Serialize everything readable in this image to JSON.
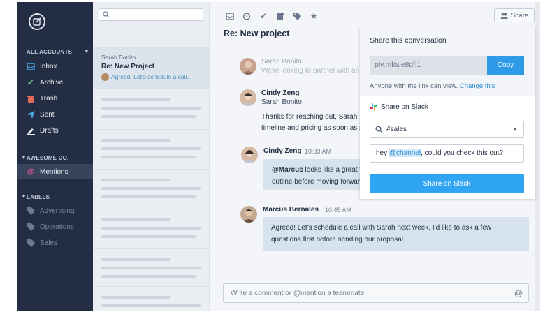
{
  "sidebar": {
    "all_accounts_label": "ALL ACCOUNTS",
    "items": [
      {
        "label": "Inbox",
        "icon": "inbox-icon"
      },
      {
        "label": "Archive",
        "icon": "check-icon"
      },
      {
        "label": "Trash",
        "icon": "trash-icon"
      },
      {
        "label": "Sent",
        "icon": "send-icon"
      },
      {
        "label": "Drafts",
        "icon": "pencil-icon"
      }
    ],
    "team_label": "AWESOME CO.",
    "mentions_label": "Mentions",
    "labels_label": "LABELS",
    "labels": [
      {
        "label": "Advertising"
      },
      {
        "label": "Operations"
      },
      {
        "label": "Sales"
      }
    ]
  },
  "list": {
    "selected": {
      "sender": "Sarah Bonito",
      "subject": "Re:  New Project",
      "preview": "Agreed! Let's schedule a call..."
    }
  },
  "conversation": {
    "title": "Re: New project",
    "share_label": "Share",
    "messages": [
      {
        "name": "Sarah Bonito",
        "text": "We're looking to partner with an age"
      },
      {
        "name": "Cindy Zeng",
        "to": "Sarah Bonito",
        "line1": "Thanks for reaching out, Sarah! I'm",
        "line2": "timeline and pricing as soon as poss"
      },
      {
        "name": "Cindy Zeng",
        "time": "10:33 AM",
        "mention": "@Marcus",
        "line1_rest": " looks like a great fit fo",
        "line2": "outline before moving forward."
      },
      {
        "name": "Marcus Bernales",
        "time": "10:45 AM",
        "line1": "Agreed! Let's schedule a call with Sarah next week, I'd like to ask a few",
        "line2": "questions first before sending our proposal."
      }
    ],
    "comment_placeholder": "Write a comment or @mention a teammate"
  },
  "share_popover": {
    "title": "Share this conversation",
    "link": "ply.ml/aie8dfj1",
    "copy_label": "Copy",
    "note": "Anyone with the link can view.",
    "change_label": "Change this",
    "slack": {
      "title": "Share on Slack",
      "channel": "#sales",
      "message_before": "hey ",
      "message_mention": "@channel",
      "message_after": ", could you check this out?",
      "button_label": "Share on Slack"
    }
  },
  "colors": {
    "sidebar_bg": "#232d43",
    "accent_blue": "#2f9be8",
    "mentions_pink": "#e0559b"
  }
}
